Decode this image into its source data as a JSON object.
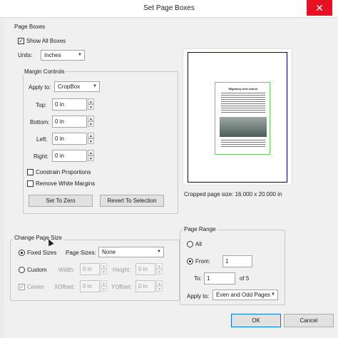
{
  "window": {
    "title": "Set Page Boxes",
    "close_glyph": "✕"
  },
  "page_boxes": {
    "group_label": "Page Boxes",
    "show_all_boxes_label": "Show All Boxes",
    "show_all_boxes_checked": true,
    "units_label": "Units:",
    "units_value": "Inches"
  },
  "margin_controls": {
    "group_label": "Margin Controls",
    "apply_to_label": "Apply to:",
    "apply_to_value": "CropBox",
    "top_label": "Top:",
    "top_value": "0 in",
    "bottom_label": "Bottom:",
    "bottom_value": "0 in",
    "left_label": "Left:",
    "left_value": "0 in",
    "right_label": "Right:",
    "right_value": "0 in",
    "constrain_label": "Constrain Proportions",
    "remove_white_label": "Remove White Margins",
    "set_to_zero_label": "Set To Zero",
    "revert_label": "Revert To Selection"
  },
  "preview": {
    "page_heading": "Migratory bird search",
    "caption": "Cropped page size: 16.000 x 20.000 in",
    "colors": {
      "crop_box": "#000080",
      "art_box": "#66cc66"
    }
  },
  "change_page_size": {
    "group_label": "Change Page Size",
    "fixed_sizes_label": "Fixed Sizes",
    "page_sizes_label": "Page Sizes:",
    "page_sizes_value": "None",
    "custom_label": "Custom",
    "width_label": "Width:",
    "width_value": "0 in",
    "height_label": "Height:",
    "height_value": "0 in",
    "center_label": "Center",
    "xoffset_label": "XOffset:",
    "xoffset_value": "0 in",
    "yoffset_label": "YOffset:",
    "yoffset_value": "0 in"
  },
  "page_range": {
    "group_label": "Page Range",
    "all_label": "All",
    "from_label": "From:",
    "from_value": "1",
    "to_label": "To:",
    "to_value": "1",
    "of_label": "of 5",
    "apply_to_label": "Apply to:",
    "apply_to_value": "Even and Odd Pages"
  },
  "footer": {
    "ok_label": "OK",
    "cancel_label": "Cancel"
  },
  "icons": {
    "dropdown": "chevron-down-icon",
    "spinner_up": "triangle-up-icon",
    "spinner_down": "triangle-down-icon",
    "checkmark": "check-icon"
  }
}
